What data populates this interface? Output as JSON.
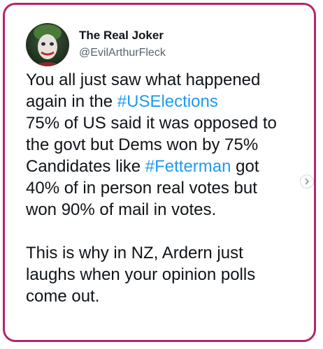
{
  "tweet": {
    "display_name": "The Real Joker",
    "handle": "@EvilArthurFleck",
    "lines": [
      {
        "before": "You all just saw what happened",
        "hashtag": "",
        "after": ""
      },
      {
        "before": "again in the ",
        "hashtag": "#USElections",
        "after": ""
      },
      {
        "before": "75% of US said it was opposed to",
        "hashtag": "",
        "after": ""
      },
      {
        "before": "the govt but Dems won by 75%",
        "hashtag": "",
        "after": ""
      },
      {
        "before": "Candidates like ",
        "hashtag": "#Fetterman",
        "after": " got"
      },
      {
        "before": "40% of in person real votes but",
        "hashtag": "",
        "after": ""
      },
      {
        "before": "won 90% of mail in votes.",
        "hashtag": "",
        "after": ""
      },
      {
        "before": "This is why in NZ, Ardern just",
        "hashtag": "",
        "after": ""
      },
      {
        "before": "laughs when your opinion polls",
        "hashtag": "",
        "after": ""
      },
      {
        "before": "come out.",
        "hashtag": "",
        "after": ""
      }
    ]
  },
  "icons": {
    "scroll_arrow": "chevron-right-icon",
    "avatar": "joker-face"
  },
  "colors": {
    "frame_border": "#b8236a",
    "hashtag": "#1d9bf0",
    "text": "#0f1419",
    "secondary_text": "#536471"
  }
}
